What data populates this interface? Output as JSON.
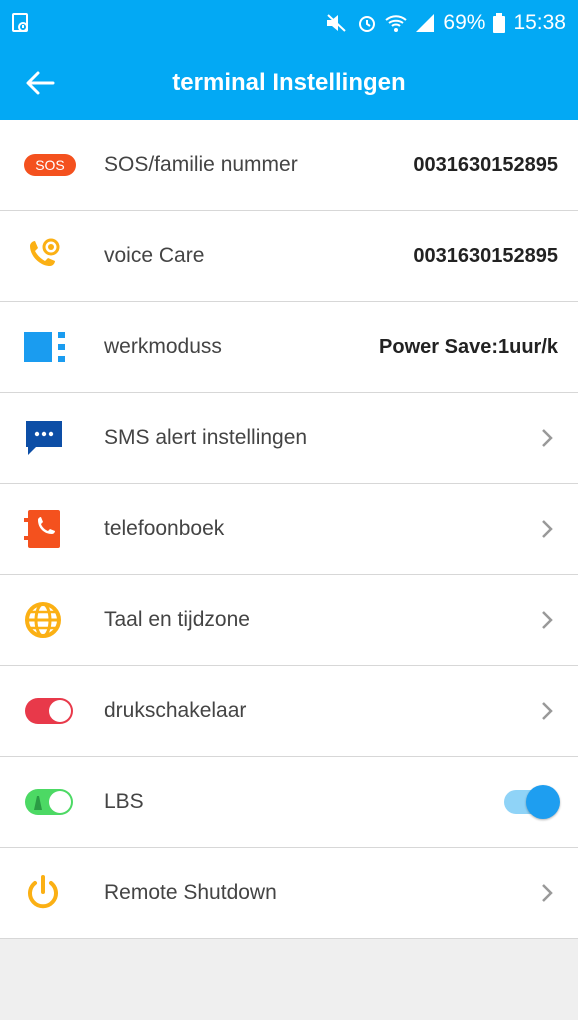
{
  "status_bar": {
    "battery_percent": "69%",
    "time": "15:38"
  },
  "header": {
    "title": "terminal Instellingen"
  },
  "settings": [
    {
      "label": "SOS/familie nummer",
      "value": "0031630152895",
      "icon": "sos-icon"
    },
    {
      "label": "voice Care",
      "value": "0031630152895",
      "icon": "voice-care-icon"
    },
    {
      "label": "werkmoduss",
      "value": "Power Save:1uur/k",
      "icon": "work-mode-icon"
    },
    {
      "label": "SMS alert instellingen",
      "icon": "sms-icon"
    },
    {
      "label": "telefoonboek",
      "icon": "phonebook-icon"
    },
    {
      "label": "Taal en tijdzone",
      "icon": "globe-icon"
    },
    {
      "label": "drukschakelaar",
      "icon": "switch-icon"
    },
    {
      "label": "LBS",
      "icon": "lbs-icon",
      "toggle_on": true
    },
    {
      "label": "Remote Shutdown",
      "icon": "power-icon"
    }
  ],
  "sos_badge_text": "SOS",
  "colors": {
    "primary": "#03a9f4",
    "sos_red": "#f4511e",
    "orange": "#fbb014",
    "blue_icon": "#1a9cf0",
    "dark_blue": "#0d4ea6",
    "red_toggle": "#e8394a",
    "green_toggle": "#4cd964"
  }
}
